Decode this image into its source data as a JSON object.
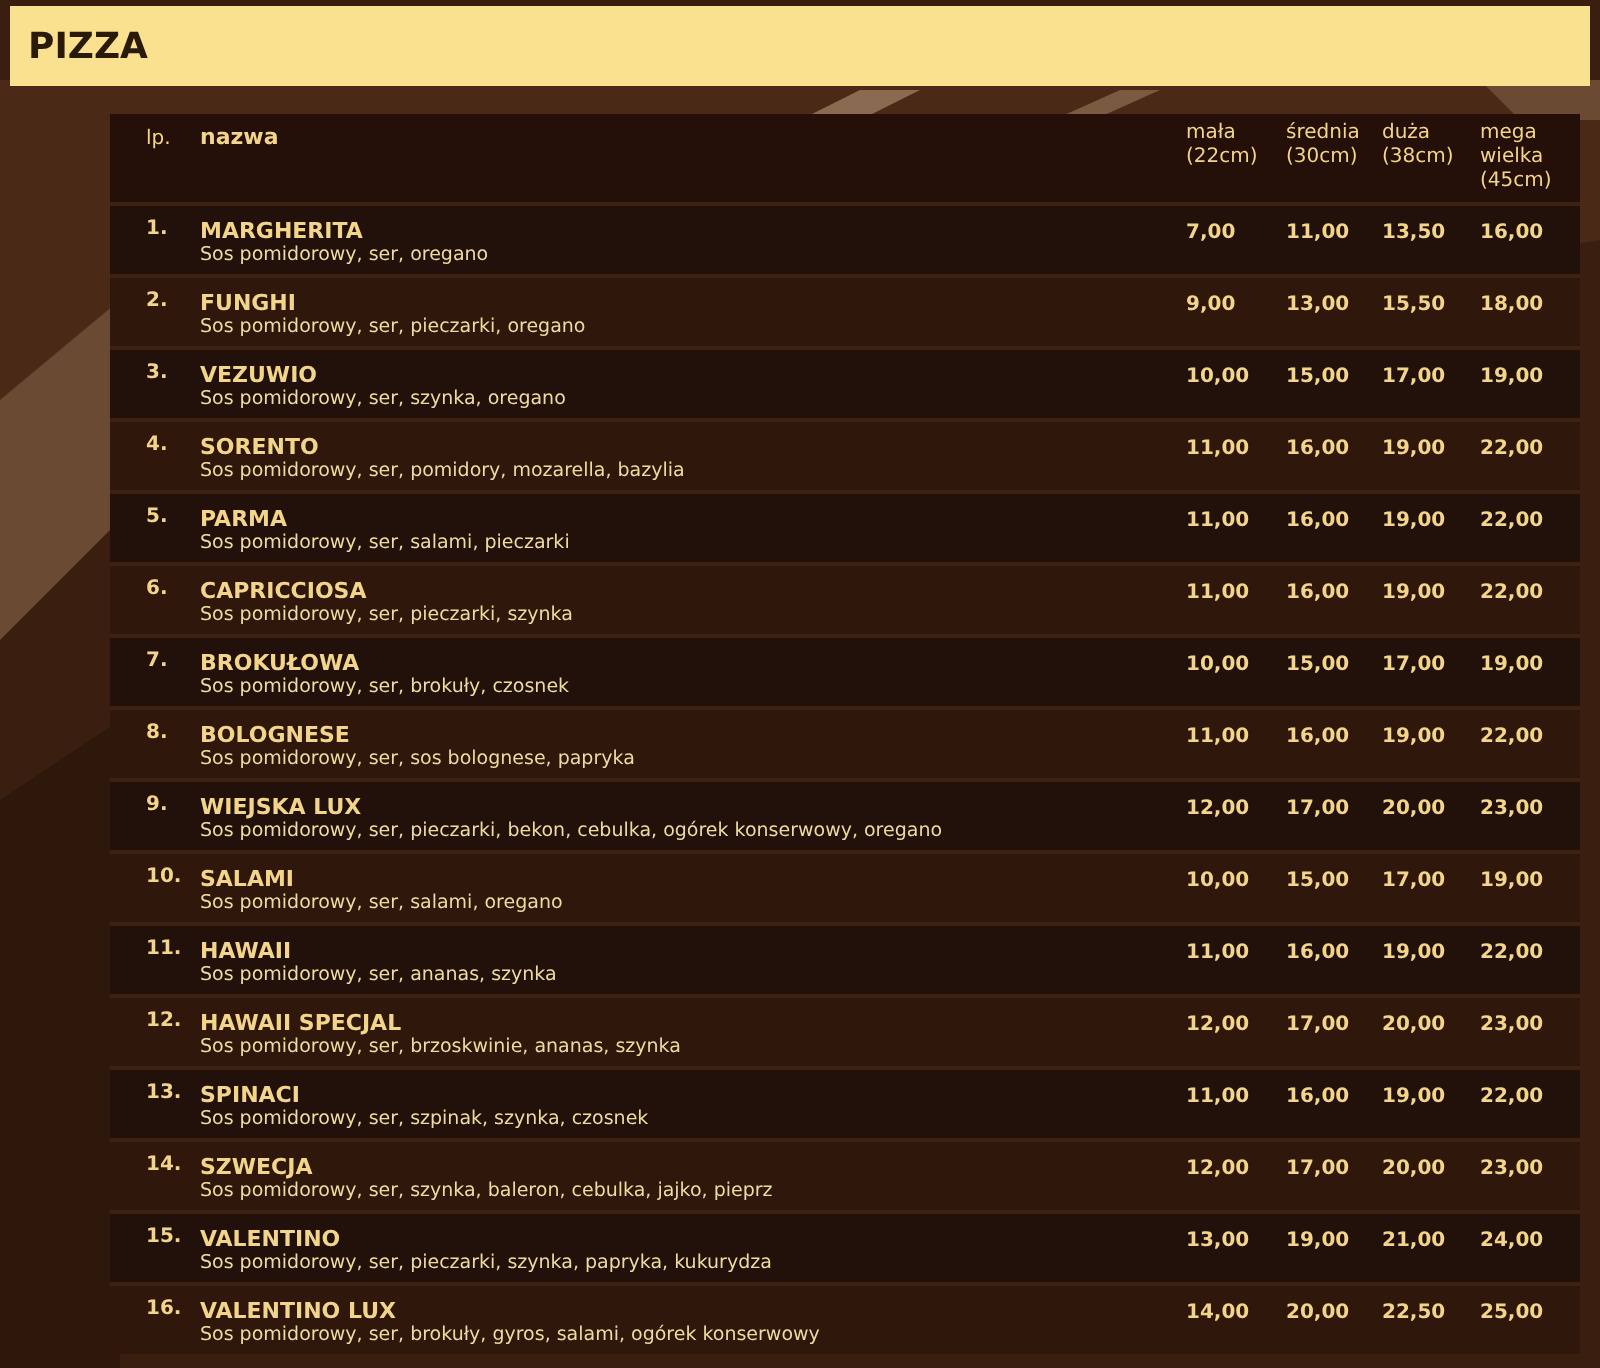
{
  "section_title": "PIZZA",
  "table": {
    "columns": [
      "lp.",
      "nazwa",
      "mała (22cm)",
      "średnia (30cm)",
      "duża (38cm)",
      "mega wielka (45cm)"
    ],
    "rows": [
      {
        "lp": "1.",
        "name": "MARGHERITA",
        "ingredients": "Sos pomidorowy, ser, oregano",
        "prices": [
          "7,00",
          "11,00",
          "13,50",
          "16,00"
        ]
      },
      {
        "lp": "2.",
        "name": "FUNGHI",
        "ingredients": "Sos pomidorowy, ser, pieczarki, oregano",
        "prices": [
          "9,00",
          "13,00",
          "15,50",
          "18,00"
        ]
      },
      {
        "lp": "3.",
        "name": "VEZUWIO",
        "ingredients": "Sos pomidorowy, ser, szynka, oregano",
        "prices": [
          "10,00",
          "15,00",
          "17,00",
          "19,00"
        ]
      },
      {
        "lp": "4.",
        "name": "SORENTO",
        "ingredients": "Sos pomidorowy, ser, pomidory, mozarella, bazylia",
        "prices": [
          "11,00",
          "16,00",
          "19,00",
          "22,00"
        ]
      },
      {
        "lp": "5.",
        "name": "PARMA",
        "ingredients": "Sos pomidorowy, ser, salami, pieczarki",
        "prices": [
          "11,00",
          "16,00",
          "19,00",
          "22,00"
        ]
      },
      {
        "lp": "6.",
        "name": "CAPRICCIOSA",
        "ingredients": "Sos pomidorowy, ser, pieczarki, szynka",
        "prices": [
          "11,00",
          "16,00",
          "19,00",
          "22,00"
        ]
      },
      {
        "lp": "7.",
        "name": "BROKUŁOWA",
        "ingredients": "Sos pomidorowy, ser, brokuły, czosnek",
        "prices": [
          "10,00",
          "15,00",
          "17,00",
          "19,00"
        ]
      },
      {
        "lp": "8.",
        "name": "BOLOGNESE",
        "ingredients": "Sos pomidorowy, ser, sos bolognese, papryka",
        "prices": [
          "11,00",
          "16,00",
          "19,00",
          "22,00"
        ]
      },
      {
        "lp": "9.",
        "name": "WIEJSKA LUX",
        "ingredients": "Sos pomidorowy, ser, pieczarki, bekon, cebulka, ogórek konserwowy, oregano",
        "prices": [
          "12,00",
          "17,00",
          "20,00",
          "23,00"
        ]
      },
      {
        "lp": "10.",
        "name": "SALAMI",
        "ingredients": "Sos pomidorowy, ser, salami, oregano",
        "prices": [
          "10,00",
          "15,00",
          "17,00",
          "19,00"
        ]
      },
      {
        "lp": "11.",
        "name": "HAWAII",
        "ingredients": "Sos pomidorowy, ser, ananas, szynka",
        "prices": [
          "11,00",
          "16,00",
          "19,00",
          "22,00"
        ]
      },
      {
        "lp": "12.",
        "name": "HAWAII SPECJAL",
        "ingredients": "Sos pomidorowy, ser, brzoskwinie, ananas, szynka",
        "prices": [
          "12,00",
          "17,00",
          "20,00",
          "23,00"
        ]
      },
      {
        "lp": "13.",
        "name": "SPINACI",
        "ingredients": "Sos pomidorowy, ser, szpinak, szynka, czosnek",
        "prices": [
          "11,00",
          "16,00",
          "19,00",
          "22,00"
        ]
      },
      {
        "lp": "14.",
        "name": "SZWECJA",
        "ingredients": "Sos pomidorowy, ser, szynka, baleron, cebulka, jajko, pieprz",
        "prices": [
          "12,00",
          "17,00",
          "20,00",
          "23,00"
        ]
      },
      {
        "lp": "15.",
        "name": "VALENTINO",
        "ingredients": "Sos pomidorowy, ser, pieczarki, szynka, papryka, kukurydza",
        "prices": [
          "13,00",
          "19,00",
          "21,00",
          "24,00"
        ]
      },
      {
        "lp": "16.",
        "name": "VALENTINO LUX",
        "ingredients": "Sos pomidorowy, ser, brokuły, gyros, salami, ogórek konserwowy",
        "prices": [
          "14,00",
          "20,00",
          "22,50",
          "25,00"
        ]
      }
    ]
  }
}
